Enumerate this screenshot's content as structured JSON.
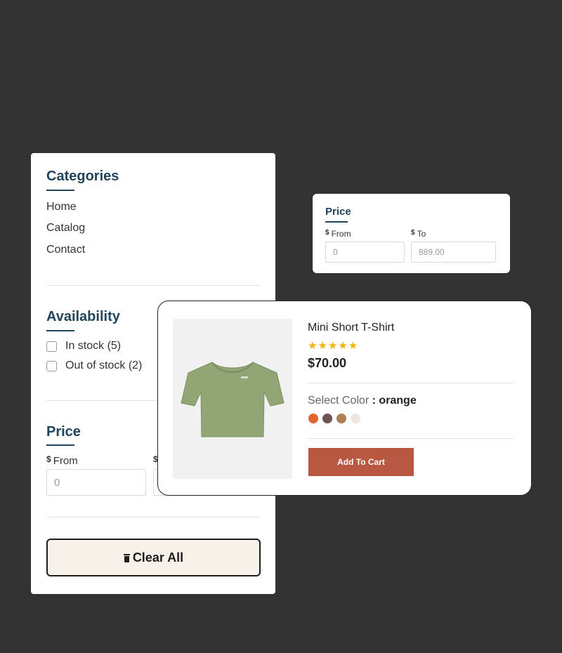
{
  "filters": {
    "categories": {
      "title": "Categories",
      "items": [
        "Home",
        "Catalog",
        "Contact"
      ]
    },
    "availability": {
      "title": "Availability",
      "options": [
        {
          "label": "In stock (5)",
          "checked": false
        },
        {
          "label": "Out of stock (2)",
          "checked": false
        }
      ]
    },
    "price": {
      "title": "Price",
      "currency": "$",
      "from_label": "From",
      "from_placeholder": "0",
      "to_label": "To",
      "to_placeholder": "889.00"
    },
    "clear_all_label": "Clear All"
  },
  "price_card": {
    "title": "Price",
    "currency": "$",
    "from_label": "From",
    "from_placeholder": "0",
    "to_label": "To",
    "to_placeholder": "889.00"
  },
  "product": {
    "title": "Mini Short T-Shirt",
    "rating": 5,
    "rating_max": 5,
    "price": "$70.00",
    "color_label": "Select Color",
    "color_separator": " : ",
    "selected_color": "orange",
    "swatches": [
      {
        "name": "orange",
        "color": "#e2632f"
      },
      {
        "name": "brown",
        "color": "#6e5350"
      },
      {
        "name": "tan",
        "color": "#ad8055"
      },
      {
        "name": "cream",
        "color": "#ece6df"
      }
    ],
    "add_to_cart_label": "Add To Cart",
    "image_icon": "t-shirt-icon",
    "image_color": "#92a574"
  },
  "colors": {
    "background": "#333333",
    "heading": "#22445a",
    "accent_button": "#b85840",
    "clear_button_bg": "#f7f1ea",
    "star": "#f5b400"
  }
}
